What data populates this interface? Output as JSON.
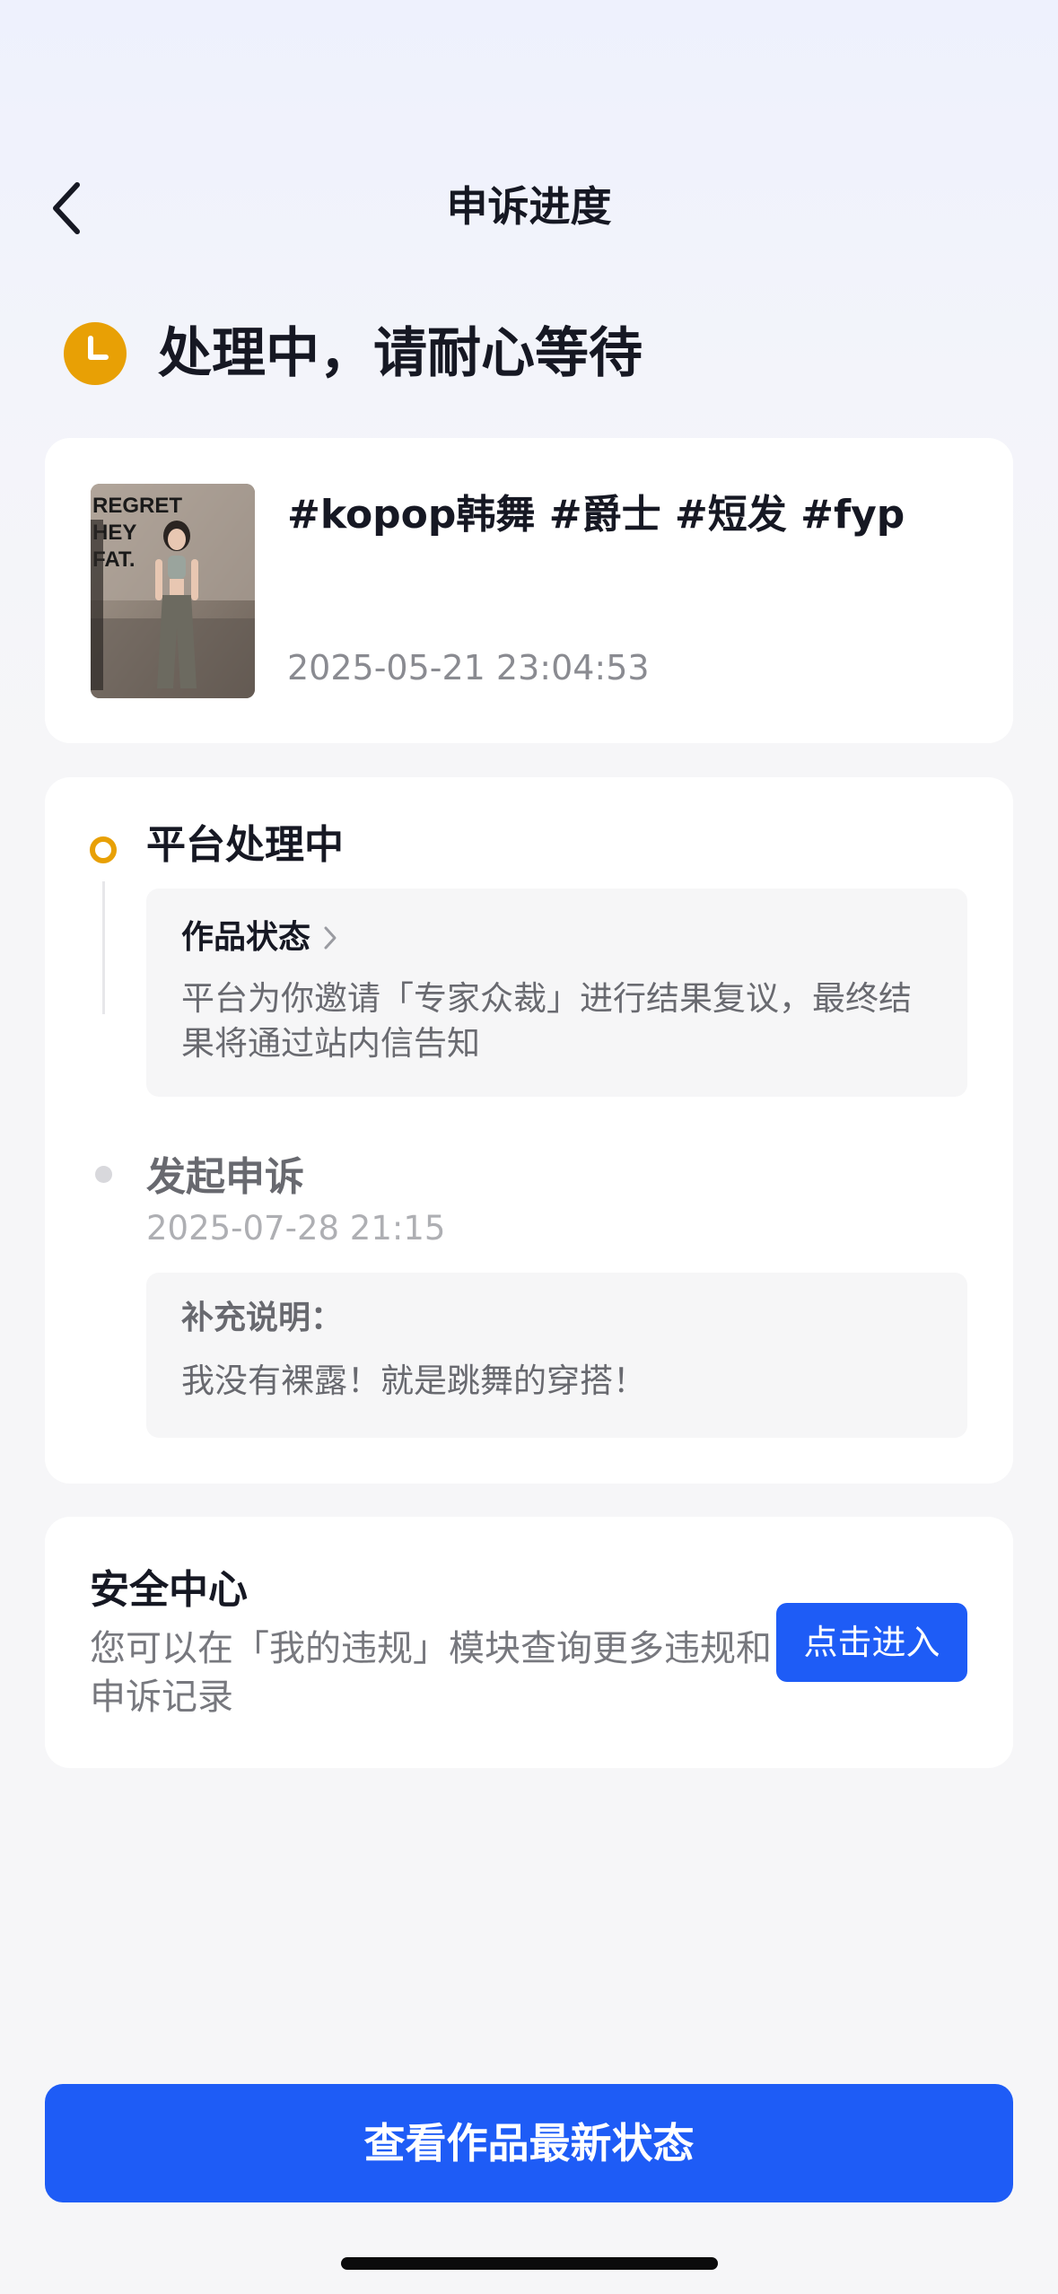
{
  "header": {
    "title": "申诉进度"
  },
  "status": {
    "title": "处理中，请耐心等待",
    "color": "#e8a005"
  },
  "video": {
    "title": "#kopop韩舞 #爵士 #短发 #fyp",
    "date": "2025-05-21 23:04:53",
    "thumbnail_text": "REGRET\nHEY\nFAT."
  },
  "timeline": {
    "steps": [
      {
        "title": "平台处理中",
        "box_label": "作品状态",
        "box_text": "平台为你邀请「专家众裁」进行结果复议，最终结果将通过站内信告知"
      },
      {
        "title": "发起申诉",
        "date": "2025-07-28 21:15",
        "box_label": "补充说明：",
        "box_text": "我没有裸露！就是跳舞的穿搭！"
      }
    ]
  },
  "safety": {
    "title": "安全中心",
    "description": "您可以在「我的违规」模块查询更多违规和申诉记录",
    "button_label": "点击进入"
  },
  "bottom_button": {
    "label": "查看作品最新状态"
  },
  "colors": {
    "accent": "#1e5cf6",
    "pending": "#e8a005"
  }
}
